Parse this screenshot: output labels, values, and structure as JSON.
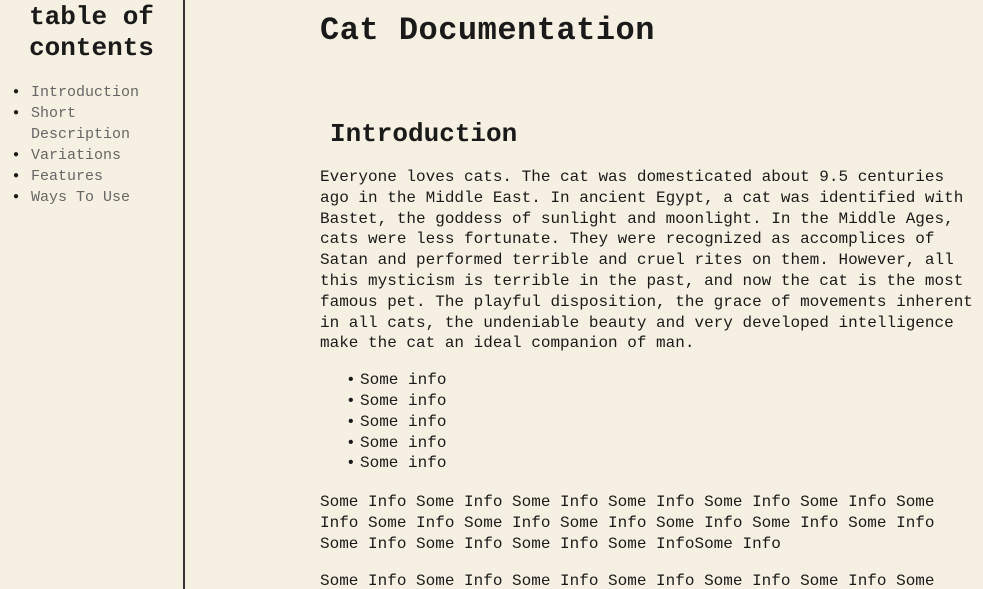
{
  "sidebar": {
    "title": "table of contents",
    "items": [
      {
        "label": "Introduction"
      },
      {
        "label": "Short Description"
      },
      {
        "label": "Variations"
      },
      {
        "label": "Features"
      },
      {
        "label": "Ways To Use"
      }
    ]
  },
  "main": {
    "title": "Cat Documentation",
    "section_title": "Introduction",
    "intro_paragraph": "Everyone loves cats. The cat was domesticated about 9.5 centuries ago in the Middle East. In ancient Egypt, a cat was identified with Bastet, the goddess of sunlight and moonlight. In the Middle Ages, cats were less fortunate. They were recognized as accomplices of Satan and performed terrible and cruel rites on them. However, all this mysticism is terrible in the past, and now the cat is the most famous pet. The playful disposition, the grace of movements inherent in all cats, the undeniable beauty and very developed intelligence make the cat an ideal companion of man.",
    "bullet_items": [
      "Some info",
      "Some info",
      "Some info",
      "Some info",
      "Some info"
    ],
    "info_paragraph_1": "Some Info Some Info Some Info Some Info Some Info Some Info Some Info Some Info Some Info Some Info Some Info Some Info Some Info Some Info Some Info Some Info Some InfoSome Info",
    "info_paragraph_2": "Some Info Some Info Some Info Some Info Some Info Some Info Some"
  }
}
